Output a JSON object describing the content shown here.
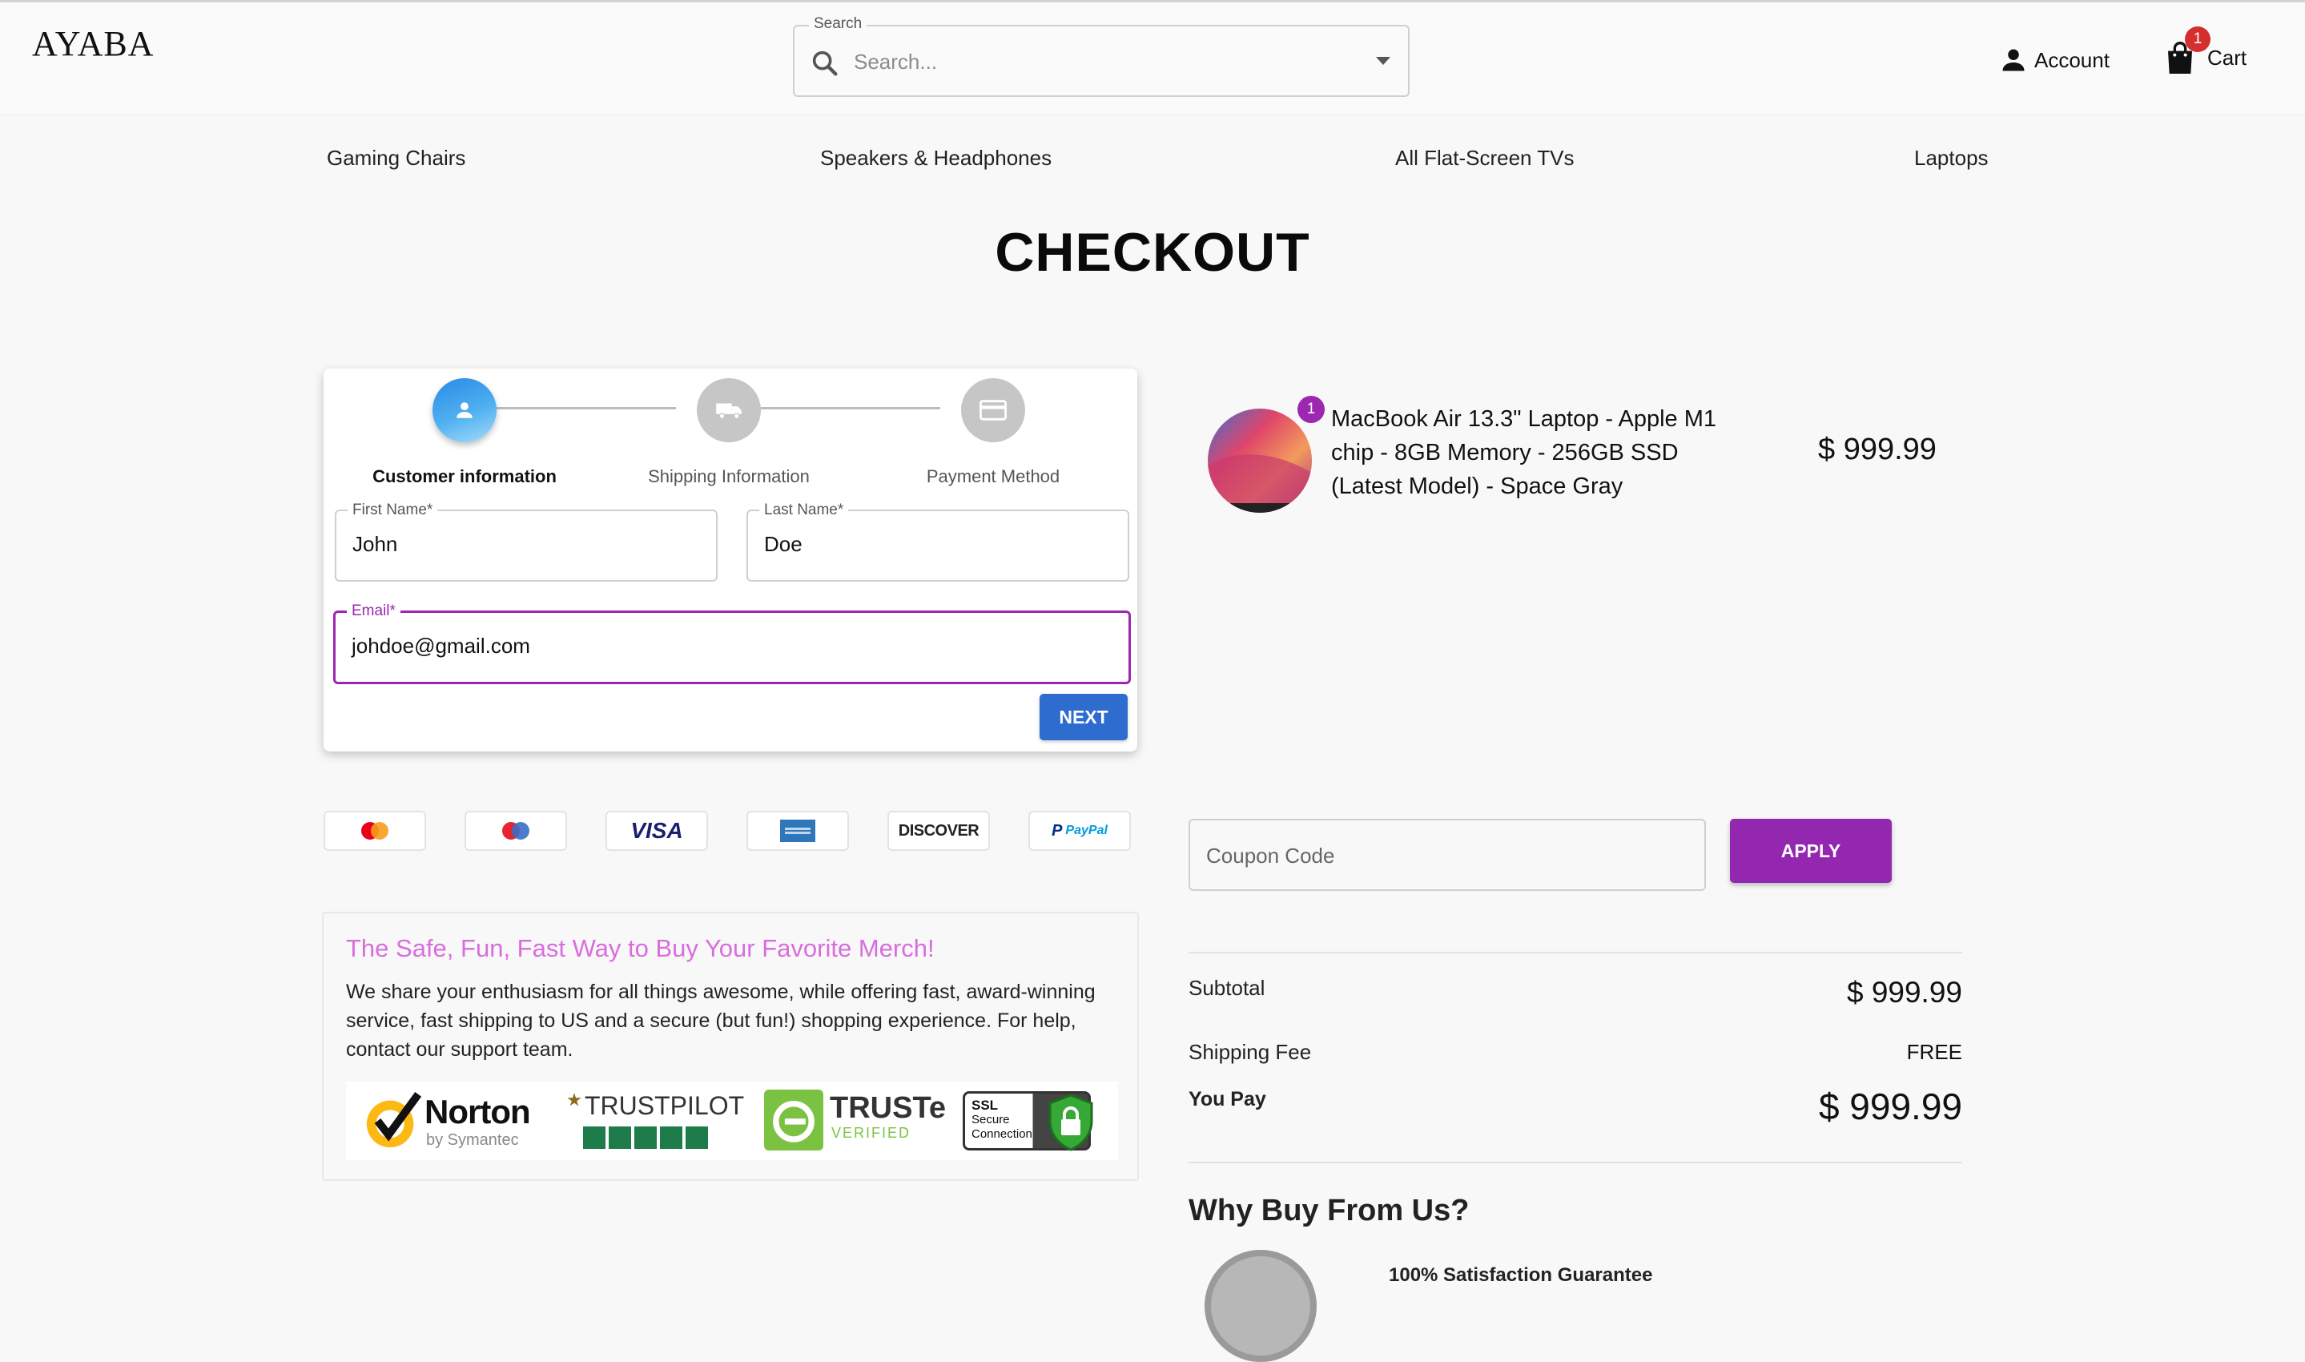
{
  "header": {
    "logo": "AYABA",
    "search": {
      "legend": "Search",
      "placeholder": "Search..."
    },
    "account_label": "Account",
    "cart_label": "Cart",
    "cart_count": "1"
  },
  "nav": {
    "items": [
      "Gaming Chairs",
      "Speakers & Headphones",
      "All Flat-Screen TVs",
      "Laptops"
    ]
  },
  "page_title": "CHECKOUT",
  "stepper": {
    "steps": [
      {
        "label": "Customer information",
        "icon": "person-icon",
        "active": true
      },
      {
        "label": "Shipping Information",
        "icon": "truck-icon",
        "active": false
      },
      {
        "label": "Payment Method",
        "icon": "credit-card-icon",
        "active": false
      }
    ],
    "fields": {
      "first_name": {
        "label": "First Name",
        "value": "John"
      },
      "last_name": {
        "label": "Last Name",
        "value": "Doe"
      },
      "email": {
        "label": "Email",
        "value": "johdoe@gmail.com"
      }
    },
    "required_marker": "*",
    "next_label": "NEXT"
  },
  "payment_methods": [
    {
      "name": "mastercard",
      "text": ""
    },
    {
      "name": "maestro",
      "text": ""
    },
    {
      "name": "visa",
      "text": "VISA"
    },
    {
      "name": "amex",
      "text": ""
    },
    {
      "name": "discover",
      "text": "DISCOVER"
    },
    {
      "name": "paypal",
      "text": "PayPal"
    }
  ],
  "promo": {
    "title": "The Safe, Fun, Fast Way to Buy Your Favorite Merch!",
    "text": "We share your enthusiasm for all things awesome, while offering fast, award-winning service, fast shipping to US and a secure (but fun!) shopping experience. For help, contact our support team.",
    "badges": {
      "norton": "Norton",
      "norton_sub": "by Symantec",
      "trustpilot": "TRUSTPILOT",
      "truste": "TRUSTe",
      "truste_sub": "VERIFIED",
      "ssl_line1": "SSL",
      "ssl_line2": "Secure",
      "ssl_line3": "Connection"
    }
  },
  "order": {
    "product": {
      "name": "MacBook Air 13.3\" Laptop - Apple M1 chip - 8GB Memory - 256GB SSD (Latest Model) - Space Gray",
      "quantity": "1",
      "price": "$ 999.99"
    },
    "coupon_placeholder": "Coupon Code",
    "apply_label": "APPLY",
    "subtotal_label": "Subtotal",
    "subtotal_value": "$ 999.99",
    "shipping_label": "Shipping Fee",
    "shipping_value": "FREE",
    "total_label": "You Pay",
    "total_value": "$ 999.99"
  },
  "why": {
    "title": "Why Buy From Us?",
    "guarantee": "100% Satisfaction Guarantee"
  },
  "colors": {
    "primary_blue": "#2f6ccf",
    "accent_purple": "#9327b0",
    "promo_pink": "#d86ddd",
    "badge_red": "#d32f2f"
  }
}
